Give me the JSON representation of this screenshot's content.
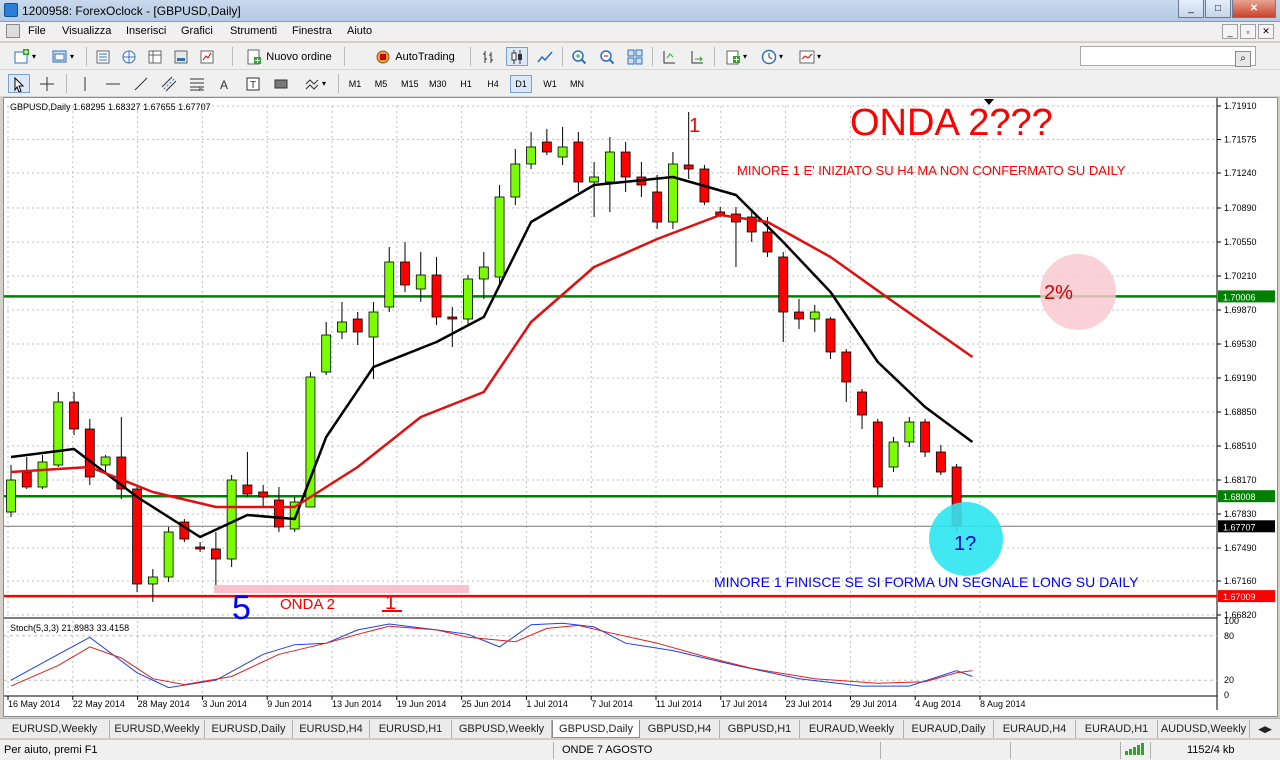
{
  "window": {
    "title": "1200958: ForexOclock - [GBPUSD,Daily]",
    "min": "_",
    "max": "□",
    "close": "✕"
  },
  "menu": [
    "File",
    "Visualizza",
    "Inserisci",
    "Grafici",
    "Strumenti",
    "Finestra",
    "Aiuto"
  ],
  "toolbar": {
    "new_order": "Nuovo ordine",
    "autotrading": "AutoTrading",
    "search_placeholder": ""
  },
  "timeframes": [
    "M1",
    "M5",
    "M15",
    "M30",
    "H1",
    "H4",
    "D1",
    "W1",
    "MN"
  ],
  "active_timeframe": "D1",
  "chart": {
    "header": "GBPUSD,Daily  1.68295 1.68327 1.67655 1.67707",
    "osc_header": "Stoch(5,3,3) 21.8983 33.4158",
    "osc_levels": [
      "100",
      "80",
      "20",
      "0"
    ],
    "annotations": {
      "onda": "ONDA 2???",
      "one_top": "1",
      "minore_top": "MINORE 1 E' INIZIATO SU H4 MA NON CONFERMATO SU DAILY",
      "pct": "2%",
      "q": "1?",
      "minore_bottom": "MINORE 1 FINISCE SE SI FORMA UN SEGNALE LONG SU DAILY",
      "five": "5",
      "onda2": "ONDA 2",
      "one_bottom": "1"
    },
    "colors": {
      "bull": "#7cfc00",
      "bear": "#ff0000",
      "ma_fast": "#000000",
      "ma_slow": "#e01010",
      "level": "#008000",
      "grid": "#c0c0c0"
    }
  },
  "chart_data": {
    "type": "candlestick",
    "title": "GBPUSD,Daily",
    "ylim": [
      1.6682,
      1.7191
    ],
    "y_ticks": [
      "1.71910",
      "1.71575",
      "1.71240",
      "1.70890",
      "1.70550",
      "1.70210",
      "1.69870",
      "1.69530",
      "1.69190",
      "1.68850",
      "1.68510",
      "1.68170",
      "1.67830",
      "1.67490",
      "1.67160",
      "1.66820"
    ],
    "x_labels": [
      "16 May 2014",
      "22 May 2014",
      "28 May 2014",
      "3 Jun 2014",
      "9 Jun 2014",
      "13 Jun 2014",
      "19 Jun 2014",
      "25 Jun 2014",
      "1 Jul 2014",
      "7 Jul 2014",
      "11 Jul 2014",
      "17 Jul 2014",
      "23 Jul 2014",
      "29 Jul 2014",
      "4 Aug 2014",
      "8 Aug 2014"
    ],
    "price_labels": [
      {
        "value": 1.70006,
        "label": "1.70006",
        "color": "#008000"
      },
      {
        "value": 1.68008,
        "label": "1.68008",
        "color": "#008000"
      },
      {
        "value": 1.67707,
        "label": "1.67707",
        "color": "#000000"
      },
      {
        "value": 1.67009,
        "label": "1.67009",
        "color": "#ff0000"
      }
    ],
    "candles": [
      {
        "o": 1.6785,
        "h": 1.6832,
        "l": 1.678,
        "c": 1.6817
      },
      {
        "o": 1.6825,
        "h": 1.684,
        "l": 1.6808,
        "c": 1.681
      },
      {
        "o": 1.681,
        "h": 1.6842,
        "l": 1.6808,
        "c": 1.6835
      },
      {
        "o": 1.6832,
        "h": 1.6905,
        "l": 1.683,
        "c": 1.6895
      },
      {
        "o": 1.6895,
        "h": 1.6905,
        "l": 1.6862,
        "c": 1.6868
      },
      {
        "o": 1.6868,
        "h": 1.6878,
        "l": 1.6812,
        "c": 1.682
      },
      {
        "o": 1.6832,
        "h": 1.6842,
        "l": 1.6825,
        "c": 1.684
      },
      {
        "o": 1.684,
        "h": 1.688,
        "l": 1.6798,
        "c": 1.6808
      },
      {
        "o": 1.6808,
        "h": 1.6812,
        "l": 1.6705,
        "c": 1.6713
      },
      {
        "o": 1.6713,
        "h": 1.6728,
        "l": 1.6695,
        "c": 1.672
      },
      {
        "o": 1.672,
        "h": 1.677,
        "l": 1.6715,
        "c": 1.6765
      },
      {
        "o": 1.6775,
        "h": 1.6778,
        "l": 1.6755,
        "c": 1.6758
      },
      {
        "o": 1.675,
        "h": 1.6755,
        "l": 1.6745,
        "c": 1.6748
      },
      {
        "o": 1.6748,
        "h": 1.6765,
        "l": 1.6712,
        "c": 1.6738
      },
      {
        "o": 1.6738,
        "h": 1.6822,
        "l": 1.673,
        "c": 1.6817
      },
      {
        "o": 1.6812,
        "h": 1.6845,
        "l": 1.68,
        "c": 1.6803
      },
      {
        "o": 1.6805,
        "h": 1.6812,
        "l": 1.679,
        "c": 1.68
      },
      {
        "o": 1.6797,
        "h": 1.681,
        "l": 1.6765,
        "c": 1.677
      },
      {
        "o": 1.6768,
        "h": 1.68,
        "l": 1.6765,
        "c": 1.6795
      },
      {
        "o": 1.679,
        "h": 1.6925,
        "l": 1.679,
        "c": 1.692
      },
      {
        "o": 1.6925,
        "h": 1.6975,
        "l": 1.6922,
        "c": 1.6962
      },
      {
        "o": 1.6965,
        "h": 1.6995,
        "l": 1.6958,
        "c": 1.6975
      },
      {
        "o": 1.6978,
        "h": 1.6985,
        "l": 1.6952,
        "c": 1.6965
      },
      {
        "o": 1.696,
        "h": 1.6995,
        "l": 1.6918,
        "c": 1.6985
      },
      {
        "o": 1.699,
        "h": 1.705,
        "l": 1.6985,
        "c": 1.7035
      },
      {
        "o": 1.7035,
        "h": 1.7055,
        "l": 1.7005,
        "c": 1.7012
      },
      {
        "o": 1.7008,
        "h": 1.7045,
        "l": 1.6995,
        "c": 1.7022
      },
      {
        "o": 1.7022,
        "h": 1.704,
        "l": 1.6972,
        "c": 1.698
      },
      {
        "o": 1.698,
        "h": 1.699,
        "l": 1.695,
        "c": 1.6978
      },
      {
        "o": 1.6978,
        "h": 1.7022,
        "l": 1.6972,
        "c": 1.7018
      },
      {
        "o": 1.7018,
        "h": 1.7045,
        "l": 1.6998,
        "c": 1.703
      },
      {
        "o": 1.702,
        "h": 1.7112,
        "l": 1.701,
        "c": 1.71
      },
      {
        "o": 1.71,
        "h": 1.7148,
        "l": 1.7092,
        "c": 1.7133
      },
      {
        "o": 1.7133,
        "h": 1.7165,
        "l": 1.7128,
        "c": 1.715
      },
      {
        "o": 1.7155,
        "h": 1.7168,
        "l": 1.7142,
        "c": 1.7145
      },
      {
        "o": 1.714,
        "h": 1.717,
        "l": 1.7132,
        "c": 1.715
      },
      {
        "o": 1.7155,
        "h": 1.7165,
        "l": 1.7105,
        "c": 1.7115
      },
      {
        "o": 1.7115,
        "h": 1.7135,
        "l": 1.708,
        "c": 1.712
      },
      {
        "o": 1.7115,
        "h": 1.716,
        "l": 1.7085,
        "c": 1.7145
      },
      {
        "o": 1.7145,
        "h": 1.7155,
        "l": 1.7105,
        "c": 1.712
      },
      {
        "o": 1.712,
        "h": 1.7135,
        "l": 1.71,
        "c": 1.7112
      },
      {
        "o": 1.7105,
        "h": 1.7122,
        "l": 1.7068,
        "c": 1.7075
      },
      {
        "o": 1.7075,
        "h": 1.7145,
        "l": 1.7068,
        "c": 1.7133
      },
      {
        "o": 1.7132,
        "h": 1.7185,
        "l": 1.7118,
        "c": 1.7128
      },
      {
        "o": 1.7128,
        "h": 1.7132,
        "l": 1.7092,
        "c": 1.7095
      },
      {
        "o": 1.7085,
        "h": 1.709,
        "l": 1.708,
        "c": 1.7082
      },
      {
        "o": 1.7083,
        "h": 1.709,
        "l": 1.703,
        "c": 1.7075
      },
      {
        "o": 1.708,
        "h": 1.7088,
        "l": 1.7055,
        "c": 1.7065
      },
      {
        "o": 1.7065,
        "h": 1.708,
        "l": 1.704,
        "c": 1.7045
      },
      {
        "o": 1.704,
        "h": 1.7045,
        "l": 1.6955,
        "c": 1.6985
      },
      {
        "o": 1.6985,
        "h": 1.6998,
        "l": 1.6968,
        "c": 1.6978
      },
      {
        "o": 1.6978,
        "h": 1.6992,
        "l": 1.6965,
        "c": 1.6985
      },
      {
        "o": 1.6978,
        "h": 1.698,
        "l": 1.6938,
        "c": 1.6945
      },
      {
        "o": 1.6945,
        "h": 1.6948,
        "l": 1.6895,
        "c": 1.6915
      },
      {
        "o": 1.6905,
        "h": 1.6908,
        "l": 1.6868,
        "c": 1.6882
      },
      {
        "o": 1.6875,
        "h": 1.6878,
        "l": 1.6802,
        "c": 1.681
      },
      {
        "o": 1.683,
        "h": 1.686,
        "l": 1.6825,
        "c": 1.6855
      },
      {
        "o": 1.6855,
        "h": 1.688,
        "l": 1.685,
        "c": 1.6875
      },
      {
        "o": 1.6875,
        "h": 1.6878,
        "l": 1.684,
        "c": 1.6845
      },
      {
        "o": 1.6845,
        "h": 1.6852,
        "l": 1.6822,
        "c": 1.6825
      },
      {
        "o": 1.683,
        "h": 1.6833,
        "l": 1.6765,
        "c": 1.6771
      }
    ],
    "series": [
      {
        "name": "",
        "color": "#000000",
        "points": [
          [
            0,
            1.684
          ],
          [
            4,
            1.6848
          ],
          [
            8,
            1.68
          ],
          [
            12,
            1.676
          ],
          [
            15,
            1.6782
          ],
          [
            18,
            1.6778
          ],
          [
            20,
            1.686
          ],
          [
            23,
            1.693
          ],
          [
            27,
            1.6955
          ],
          [
            30,
            1.698
          ],
          [
            33,
            1.7075
          ],
          [
            37,
            1.7112
          ],
          [
            42,
            1.712
          ],
          [
            46,
            1.7102
          ],
          [
            49,
            1.7055
          ],
          [
            52,
            1.7005
          ],
          [
            55,
            1.6935
          ],
          [
            58,
            1.689
          ],
          [
            61,
            1.6855
          ]
        ]
      },
      {
        "name": "",
        "color": "#e01010",
        "points": [
          [
            0,
            1.6825
          ],
          [
            5,
            1.683
          ],
          [
            9,
            1.6805
          ],
          [
            13,
            1.679
          ],
          [
            18,
            1.679
          ],
          [
            22,
            1.683
          ],
          [
            26,
            1.688
          ],
          [
            30,
            1.6905
          ],
          [
            33,
            1.6975
          ],
          [
            37,
            1.703
          ],
          [
            41,
            1.7058
          ],
          [
            45,
            1.7082
          ],
          [
            48,
            1.7075
          ],
          [
            52,
            1.704
          ],
          [
            56,
            1.6995
          ],
          [
            61,
            1.694
          ]
        ]
      }
    ],
    "levels": [
      1.70006,
      1.68008,
      1.67009
    ],
    "stochastic": {
      "name": "Stoch(5,3,3)",
      "main": [
        [
          0,
          20
        ],
        [
          3,
          55
        ],
        [
          5,
          78
        ],
        [
          8,
          30
        ],
        [
          10,
          10
        ],
        [
          13,
          20
        ],
        [
          16,
          55
        ],
        [
          18,
          68
        ],
        [
          20,
          70
        ],
        [
          22,
          88
        ],
        [
          24,
          96
        ],
        [
          27,
          88
        ],
        [
          29,
          82
        ],
        [
          31,
          65
        ],
        [
          33,
          95
        ],
        [
          35,
          97
        ],
        [
          37,
          92
        ],
        [
          39,
          70
        ],
        [
          42,
          60
        ],
        [
          46,
          40
        ],
        [
          50,
          22
        ],
        [
          54,
          12
        ],
        [
          57,
          12
        ],
        [
          60,
          33
        ],
        [
          61,
          25
        ]
      ],
      "signal": [
        [
          0,
          12
        ],
        [
          3,
          40
        ],
        [
          5,
          65
        ],
        [
          7,
          50
        ],
        [
          9,
          22
        ],
        [
          11,
          14
        ],
        [
          14,
          25
        ],
        [
          17,
          55
        ],
        [
          20,
          70
        ],
        [
          22,
          82
        ],
        [
          24,
          93
        ],
        [
          27,
          88
        ],
        [
          29,
          78
        ],
        [
          32,
          72
        ],
        [
          34,
          90
        ],
        [
          36,
          94
        ],
        [
          38,
          84
        ],
        [
          41,
          70
        ],
        [
          44,
          52
        ],
        [
          47,
          36
        ],
        [
          51,
          22
        ],
        [
          55,
          16
        ],
        [
          58,
          18
        ],
        [
          60,
          30
        ],
        [
          61,
          33
        ]
      ]
    }
  },
  "tabs": [
    "EURUSD,Weekly",
    "EURUSD,Weekly",
    "EURUSD,Daily",
    "EURUSD,H4",
    "EURUSD,H1",
    "GBPUSD,Weekly",
    "GBPUSD,Daily",
    "GBPUSD,H4",
    "GBPUSD,H1",
    "EURAUD,Weekly",
    "EURAUD,Daily",
    "EURAUD,H4",
    "EURAUD,H1",
    "AUDUSD,Weekly"
  ],
  "active_tab": 6,
  "status": {
    "help": "Per aiuto, premi F1",
    "profile": "ONDE 7 AGOSTO",
    "traffic": "1152/4 kb"
  }
}
